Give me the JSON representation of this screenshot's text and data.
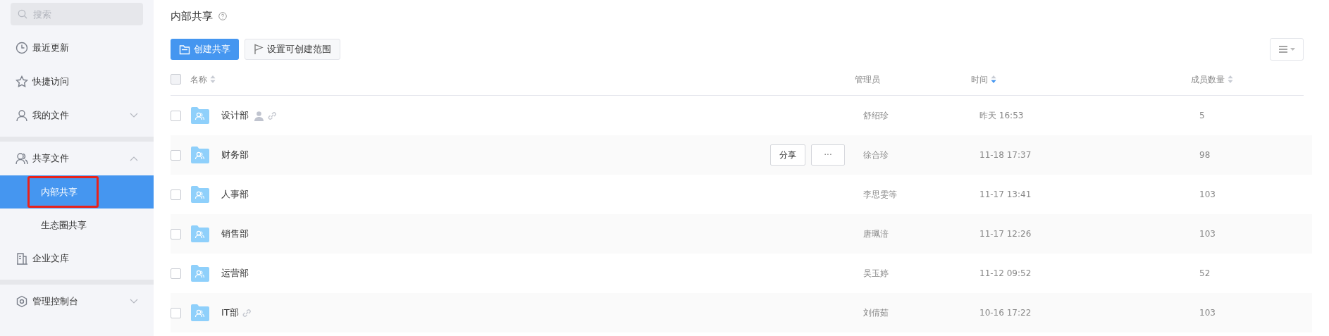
{
  "sidebar": {
    "search": {
      "placeholder": "搜索"
    },
    "groups": [
      {
        "items": [
          {
            "label": "最近更新",
            "selected": false
          },
          {
            "label": "快捷访问",
            "selected": false
          },
          {
            "label": "我的文件",
            "selected": false,
            "expanded": false
          }
        ]
      },
      {
        "items": [
          {
            "label": "共享文件",
            "selected": false,
            "expanded": true,
            "children": [
              {
                "label": "内部共享",
                "selected": true,
                "annotated": true
              },
              {
                "label": "生态圈共享",
                "selected": false,
                "annotated": false
              }
            ]
          },
          {
            "label": "企业文库",
            "selected": false
          }
        ]
      },
      {
        "items": [
          {
            "label": "管理控制台",
            "selected": false,
            "expanded": false
          }
        ]
      }
    ]
  },
  "page": {
    "title": "内部共享",
    "buttons": [
      {
        "label": "创建共享",
        "kind": "primary"
      },
      {
        "label": "设置可创建范围",
        "kind": "secondary"
      }
    ]
  },
  "table": {
    "select_all": {
      "checked": false
    },
    "columns": [
      {
        "label": "名称",
        "sortable": true,
        "sort_active": false
      },
      {
        "label": "管理员",
        "sortable": false
      },
      {
        "label": "时间",
        "sortable": true,
        "sort_active": true
      },
      {
        "label": "成员数量",
        "sortable": true,
        "sort_active": false
      }
    ],
    "rows": [
      {
        "name": "设计部",
        "member_icon": true,
        "link_icon": true,
        "checked": false,
        "admin": "舒绍珍",
        "time": "昨天 16:53",
        "members": "5"
      },
      {
        "name": "财务部",
        "member_icon": false,
        "link_icon": false,
        "actions": [
          "分享",
          "···"
        ],
        "checked": false,
        "admin": "徐合珍",
        "time": "11-18 17:37",
        "members": "98"
      },
      {
        "name": "人事部",
        "member_icon": false,
        "link_icon": false,
        "checked": false,
        "admin": "李思雯等",
        "time": "11-17 13:41",
        "members": "103"
      },
      {
        "name": "销售部",
        "member_icon": false,
        "link_icon": false,
        "checked": false,
        "admin": "唐珮涪",
        "time": "11-17 12:26",
        "members": "103"
      },
      {
        "name": "运营部",
        "member_icon": false,
        "link_icon": false,
        "checked": false,
        "admin": "吴玉婷",
        "time": "11-12 09:52",
        "members": "52"
      },
      {
        "name": "IT部",
        "member_icon": false,
        "link_icon": true,
        "checked": false,
        "admin": "刘倩茹",
        "time": "10-16 17:22",
        "members": "103"
      }
    ]
  }
}
